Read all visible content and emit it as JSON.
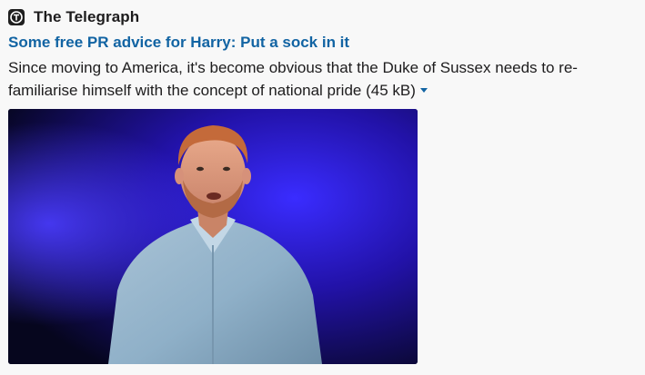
{
  "unfurl": {
    "source_name": "The Telegraph",
    "source_icon": "telegraph-logo-icon",
    "headline": "Some free PR advice for Harry: Put a sock in it",
    "description": "Since moving to America, it's become obvious that the Duke of Sussex needs to re-familiarise himself with the concept of national pride",
    "file_size": "(45 kB)",
    "toggle_icon": "caret-down-icon",
    "image": {
      "icon": "article-photo"
    }
  },
  "colors": {
    "link": "#1264a3",
    "text": "#1d1c1d",
    "background": "#f8f8f8",
    "stage_blue": "#2a1fbf"
  }
}
